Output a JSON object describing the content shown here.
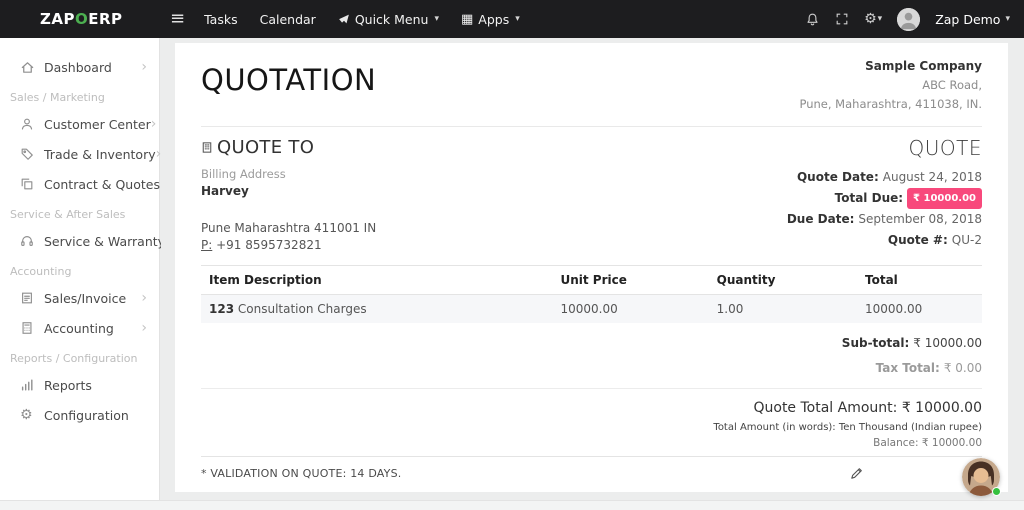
{
  "colors": {
    "accent_green": "#4caf50",
    "badge_bg": "#f8497c",
    "nav_bg": "#1d1d1f"
  },
  "icons": {
    "hamburger": "≡",
    "apps_grid": "▦",
    "gear": "⚙",
    "caret_down": "▾",
    "chevron_right": "›"
  },
  "navbar": {
    "logo": {
      "zap": "ZAP",
      "o": "O",
      "erp": "ERP"
    },
    "tasks": "Tasks",
    "calendar": "Calendar",
    "quick_menu": "Quick Menu",
    "apps": "Apps",
    "user": "Zap Demo"
  },
  "sidebar": {
    "section_labels": [
      "Sales / Marketing",
      "Service & After Sales",
      "Accounting",
      "Reports / Configuration"
    ],
    "items": [
      {
        "label": "Dashboard"
      },
      {
        "label": "Customer Center"
      },
      {
        "label": "Trade & Inventory"
      },
      {
        "label": "Contract & Quotes"
      },
      {
        "label": "Service & Warranty"
      },
      {
        "label": "Sales/Invoice"
      },
      {
        "label": "Accounting"
      },
      {
        "label": "Reports"
      },
      {
        "label": "Configuration"
      }
    ]
  },
  "quote": {
    "title": "QUOTATION",
    "company": {
      "name": "Sample Company",
      "address1": "ABC Road,",
      "address2": "Pune, Maharashtra, 411038, IN."
    },
    "quote_to_label": "QUOTE TO",
    "header_right": "QUOTE",
    "billing": {
      "label": "Billing Address",
      "name": "Harvey",
      "address": "Pune Maharashtra 411001 IN",
      "phone_label": "P:",
      "phone": "+91 8595732821"
    },
    "meta": {
      "quote_date_label": "Quote Date:",
      "quote_date": "August 24, 2018",
      "total_due_label": "Total Due:",
      "total_due": "₹ 10000.00",
      "due_date_label": "Due Date:",
      "due_date": "September 08, 2018",
      "quote_no_label": "Quote #:",
      "quote_no": "QU-2"
    },
    "table": {
      "headers": [
        "Item Description",
        "Unit Price",
        "Quantity",
        "Total"
      ],
      "rows": [
        {
          "code": "123",
          "desc": "Consultation Charges",
          "unit_price": "10000.00",
          "qty": "1.00",
          "total": "10000.00"
        }
      ]
    },
    "totals": {
      "subtotal_label": "Sub-total:",
      "subtotal_value": "₹ 10000.00",
      "tax_label": "Tax Total:",
      "tax_value": "₹ 0.00",
      "grand_label": "Quote Total Amount:",
      "grand_value": "₹ 10000.00",
      "in_words": "Total Amount (in words): Ten Thousand (Indian rupee)",
      "balance_label": "Balance:",
      "balance_value": "₹ 10000.00"
    },
    "footer_note": "* VALIDATION ON QUOTE: 14 DAYS."
  }
}
